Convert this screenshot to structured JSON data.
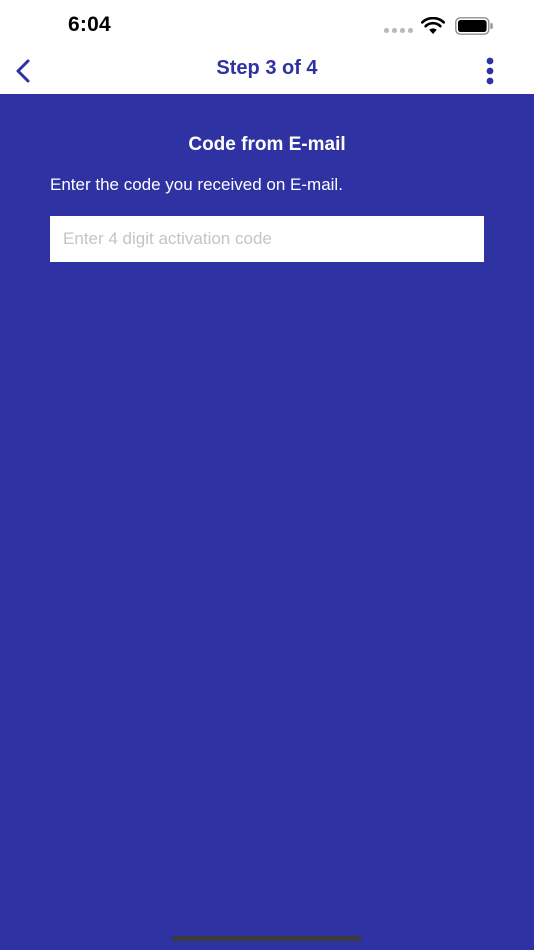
{
  "status_bar": {
    "time": "6:04",
    "icons": [
      "signal-dots-icon",
      "wifi-icon",
      "battery-icon"
    ]
  },
  "nav": {
    "back_icon": "chevron-left-icon",
    "title": "Step 3 of 4",
    "more_icon": "vertical-ellipsis-icon"
  },
  "content": {
    "title": "Code from E-mail",
    "description": "Enter the code you received on E-mail.",
    "code_input": {
      "placeholder": "Enter 4 digit activation code",
      "value": ""
    }
  },
  "colors": {
    "brand": "#2e32a2",
    "background": "#2e32a2",
    "header_background": "#ffffff",
    "text_on_brand": "#ffffff"
  }
}
